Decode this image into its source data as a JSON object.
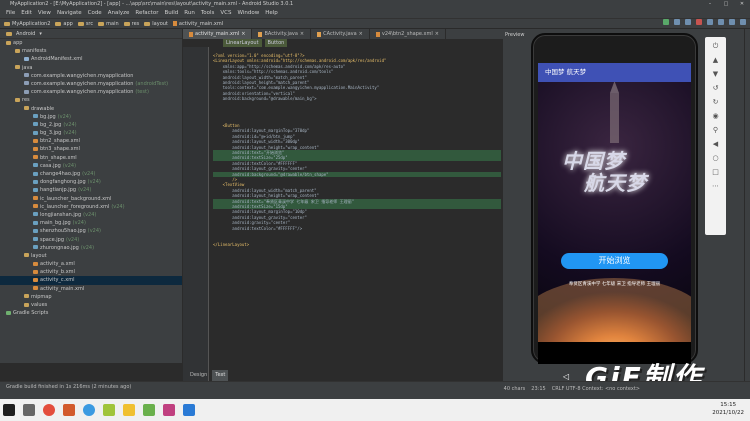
{
  "window": {
    "title": "MyApplication2 - [E:\\MyApplication2] - [app] - ...\\app\\src\\main\\res\\layout\\activity_main.xml - Android Studio 3.0.1"
  },
  "menu": [
    "File",
    "Edit",
    "View",
    "Navigate",
    "Code",
    "Analyze",
    "Refactor",
    "Build",
    "Run",
    "Tools",
    "VCS",
    "Window",
    "Help"
  ],
  "nav": {
    "crumbs": [
      "MyApplication2",
      "app",
      "src",
      "main",
      "res",
      "layout",
      "activity_main.xml"
    ]
  },
  "project_panel": {
    "header": "Android",
    "tree": [
      {
        "label": "app",
        "depth": 0,
        "icon": "folder-icon"
      },
      {
        "label": "manifests",
        "depth": 1,
        "icon": "folder-icon"
      },
      {
        "label": "AndroidManifest.xml",
        "depth": 2,
        "icon": "manifest-icon"
      },
      {
        "label": "java",
        "depth": 1,
        "icon": "folder-icon"
      },
      {
        "label": "com.example.wangyichen.myapplication",
        "depth": 2,
        "icon": "package-icon",
        "extra": ""
      },
      {
        "label": "com.example.wangyichen.myapplication",
        "depth": 2,
        "icon": "package-icon",
        "extra": "(androidTest)"
      },
      {
        "label": "com.example.wangyichen.myapplication",
        "depth": 2,
        "icon": "package-icon",
        "extra": "(test)"
      },
      {
        "label": "res",
        "depth": 1,
        "icon": "folder-icon"
      },
      {
        "label": "drawable",
        "depth": 2,
        "icon": "folder-icon"
      },
      {
        "label": "bg.jpg",
        "depth": 3,
        "icon": "image-icon",
        "extra": "(v24)"
      },
      {
        "label": "bg_2.jpg",
        "depth": 3,
        "icon": "image-icon",
        "extra": "(v24)"
      },
      {
        "label": "bg_3.jpg",
        "depth": 3,
        "icon": "image-icon",
        "extra": "(v24)"
      },
      {
        "label": "btn2_shape.xml",
        "depth": 3,
        "icon": "xml-icon",
        "extra": ""
      },
      {
        "label": "btn3_shape.xml",
        "depth": 3,
        "icon": "xml-icon",
        "extra": ""
      },
      {
        "label": "btn_shape.xml",
        "depth": 3,
        "icon": "xml-icon",
        "extra": ""
      },
      {
        "label": "casa.jpg",
        "depth": 3,
        "icon": "image-icon",
        "extra": "(v24)"
      },
      {
        "label": "change4hao.jpg",
        "depth": 3,
        "icon": "image-icon",
        "extra": "(v24)"
      },
      {
        "label": "dongfanghong.jpg",
        "depth": 3,
        "icon": "image-icon",
        "extra": "(v24)"
      },
      {
        "label": "hangtianjp.jpg",
        "depth": 3,
        "icon": "image-icon",
        "extra": "(v24)"
      },
      {
        "label": "ic_launcher_background.xml",
        "depth": 3,
        "icon": "xml-icon",
        "extra": ""
      },
      {
        "label": "ic_launcher_foreground.xml",
        "depth": 3,
        "icon": "xml-icon",
        "extra": "(v24)"
      },
      {
        "label": "longjianshan.jpg",
        "depth": 3,
        "icon": "image-icon",
        "extra": "(v24)"
      },
      {
        "label": "main_bg.jpg",
        "depth": 3,
        "icon": "image-icon",
        "extra": "(v24)"
      },
      {
        "label": "shenzhou5hao.jpg",
        "depth": 3,
        "icon": "image-icon",
        "extra": "(v24)"
      },
      {
        "label": "space.jpg",
        "depth": 3,
        "icon": "image-icon",
        "extra": "(v24)"
      },
      {
        "label": "zhurongnao.jpg",
        "depth": 3,
        "icon": "image-icon",
        "extra": "(v24)"
      },
      {
        "label": "layout",
        "depth": 2,
        "icon": "folder-icon"
      },
      {
        "label": "activity_a.xml",
        "depth": 3,
        "icon": "xml-icon",
        "extra": ""
      },
      {
        "label": "activity_b.xml",
        "depth": 3,
        "icon": "xml-icon",
        "extra": ""
      },
      {
        "label": "activity_c.xml",
        "depth": 3,
        "icon": "xml-icon",
        "extra": "",
        "selected": true
      },
      {
        "label": "activity_main.xml",
        "depth": 3,
        "icon": "xml-icon",
        "extra": ""
      },
      {
        "label": "mipmap",
        "depth": 2,
        "icon": "folder-icon"
      },
      {
        "label": "values",
        "depth": 2,
        "icon": "folder-icon"
      },
      {
        "label": "Gradle Scripts",
        "depth": 0,
        "icon": "gradle-icon"
      }
    ]
  },
  "editor": {
    "tabs": [
      {
        "label": "activity_main.xml",
        "active": true
      },
      {
        "label": "BActivity.java",
        "active": false
      },
      {
        "label": "CActivity.java",
        "active": false
      },
      {
        "label": "v24\\btn2_shape.xml",
        "active": false
      }
    ],
    "breadcrumb": [
      "LinearLayout",
      "Button"
    ],
    "bottom_tabs": [
      "Design",
      "Text"
    ],
    "code": [
      "<?xml version=\"1.0\" encoding=\"utf-8\"?>",
      "<LinearLayout xmlns:android=\"http://schemas.android.com/apk/res/android\"",
      "    xmlns:app=\"http://schemas.android.com/apk/res-auto\"",
      "    xmlns:tools=\"http://schemas.android.com/tools\"",
      "    android:layout_width=\"match_parent\"",
      "    android:layout_height=\"match_parent\"",
      "    tools:context=\"com.example.wangyichen.myapplication.MainActivity\"",
      "    android:orientation=\"vertical\"",
      "    android:background=\"@drawable/main_bg\">",
      "",
      "",
      "",
      "",
      "    <Button",
      "        android:layout_marginTop=\"370dp\"",
      "        android:id=\"@+id/btn_jump\"",
      "        android:layout_width=\"300dp\"",
      "        android:layout_height=\"wrap_content\"",
      "        android:text=\"开始浏览\"",
      "        android:textSize=\"25dp\"",
      "        android:textColor=\"#FFFFFF\"",
      "        android:layout_gravity=\"center\"",
      "        android:background=\"@drawable/btn_shape\"",
      "        />",
      "    <TextView",
      "        android:layout_width=\"match_parent\"",
      "        android:layout_height=\"wrap_content\"",
      "        android:text=\"奉贤区青溪中学 七年级 宋卫 指导老师 王理丽\"",
      "        android:textSize=\"15dp\"",
      "        android:layout_marginTop=\"10dp\"",
      "        android:layout_gravity=\"center\"",
      "        android:gravity=\"center\"",
      "        android:textColor=\"#FFFFFF\"/>",
      "",
      "",
      "</LinearLayout>"
    ],
    "highlighted_lines": [
      18,
      19,
      22,
      27,
      28
    ]
  },
  "preview": {
    "label": "Preview"
  },
  "phone": {
    "app_title": "中国梦 航天梦",
    "hero_line1": "中国梦",
    "hero_line2": "航天梦",
    "button_label": "开始浏览",
    "credit": "奉贤区青溪中学 七年级 宋卫 指导老师 王理丽"
  },
  "watermark": "GiF制作",
  "status": {
    "message": "Gradle build finished in 1s 216ms (2 minutes ago)",
    "chars": "40 chars",
    "position": "23:15",
    "encoding": "CRLF  UTF-8  Context: <no context>"
  },
  "tray": {
    "time": "15:15",
    "date": "2021/10/22"
  }
}
